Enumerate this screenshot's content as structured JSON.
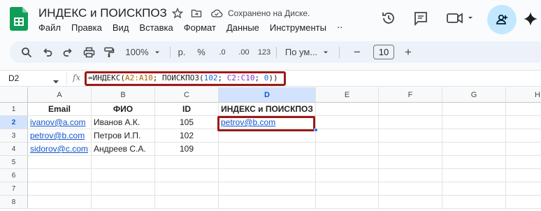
{
  "header": {
    "title": "ИНДЕКС и ПОИСКПОЗ",
    "saved_status": "Сохранено на Диске.",
    "menu": [
      "Файл",
      "Правка",
      "Вид",
      "Вставка",
      "Формат",
      "Данные",
      "Инструменты",
      "⋅⋅"
    ]
  },
  "toolbar": {
    "zoom": "100%",
    "currency": "р.",
    "percent": "%",
    "decrease_decimals": ".0",
    "increase_decimals": ".00",
    "number_format": "123",
    "font": "По ум...",
    "font_size": "10",
    "minus": "−",
    "plus": "+"
  },
  "formula_bar": {
    "name_box": "D2",
    "fx": "fx",
    "formula_parts": [
      "=ИНДЕКС(",
      "A2:A10",
      "; ПОИСКПОЗ(",
      "102",
      "; ",
      "C2:C10",
      "; ",
      "0",
      "))"
    ]
  },
  "grid": {
    "columns": [
      "A",
      "B",
      "C",
      "D",
      "E",
      "F",
      "G",
      "H"
    ],
    "rows": [
      "1",
      "2",
      "3",
      "4",
      "5",
      "6",
      "7",
      "8"
    ],
    "selected_column": "D",
    "selected_row": "2",
    "cells": {
      "A1": "Email",
      "B1": "ФИО",
      "C1": "ID",
      "D1": "ИНДЕКС и ПОИСКПОЗ",
      "A2": "ivanov@a.com",
      "B2": "Иванов А.К.",
      "C2": "105",
      "D2": "petrov@b.com",
      "A3": "petrov@b.com",
      "B3": "Петров И.П.",
      "C3": "102",
      "A4": "sidorov@c.com",
      "B4": "Андреев С.А.",
      "C4": "109"
    }
  },
  "colors": {
    "highlight_box": "#9b1a1a",
    "link": "#1155cc",
    "selection": "#d3e3fd",
    "share_button": "#c2e7ff"
  }
}
